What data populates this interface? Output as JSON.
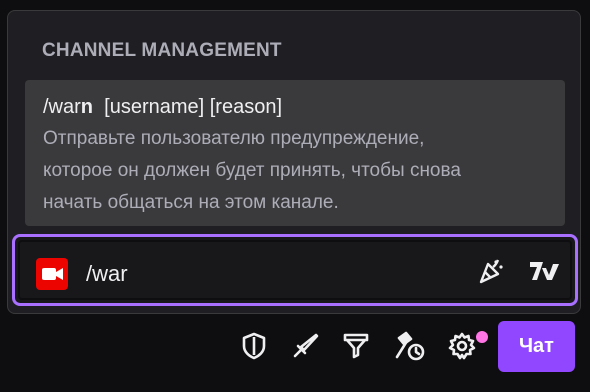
{
  "section": {
    "title": "CHANNEL MANAGEMENT"
  },
  "suggestion": {
    "command_typed": "/war",
    "command_rest": "n",
    "args": "[username] [reason]",
    "description_lines": [
      "Отправьте пользователю предупреждение,",
      "которое он должен будет принять, чтобы снова",
      "начать общаться на этом канале."
    ]
  },
  "chat_input": {
    "value": "/war"
  },
  "icons": {
    "camera": "video-camera-icon",
    "emote_party": "party-popper-icon",
    "seventv": "seventv-logo-icon",
    "shield": "shield-icon",
    "sword": "sword-icon",
    "funnel": "funnel-icon",
    "mod_actions": "hammer-clock-icon",
    "settings": "gear-icon"
  },
  "footer": {
    "chat_button_label": "Чат"
  },
  "colors": {
    "accent": "#9147ff",
    "focus_border": "#a970ff",
    "camera_red": "#eb0400",
    "notification_dot": "#ff75e6"
  }
}
